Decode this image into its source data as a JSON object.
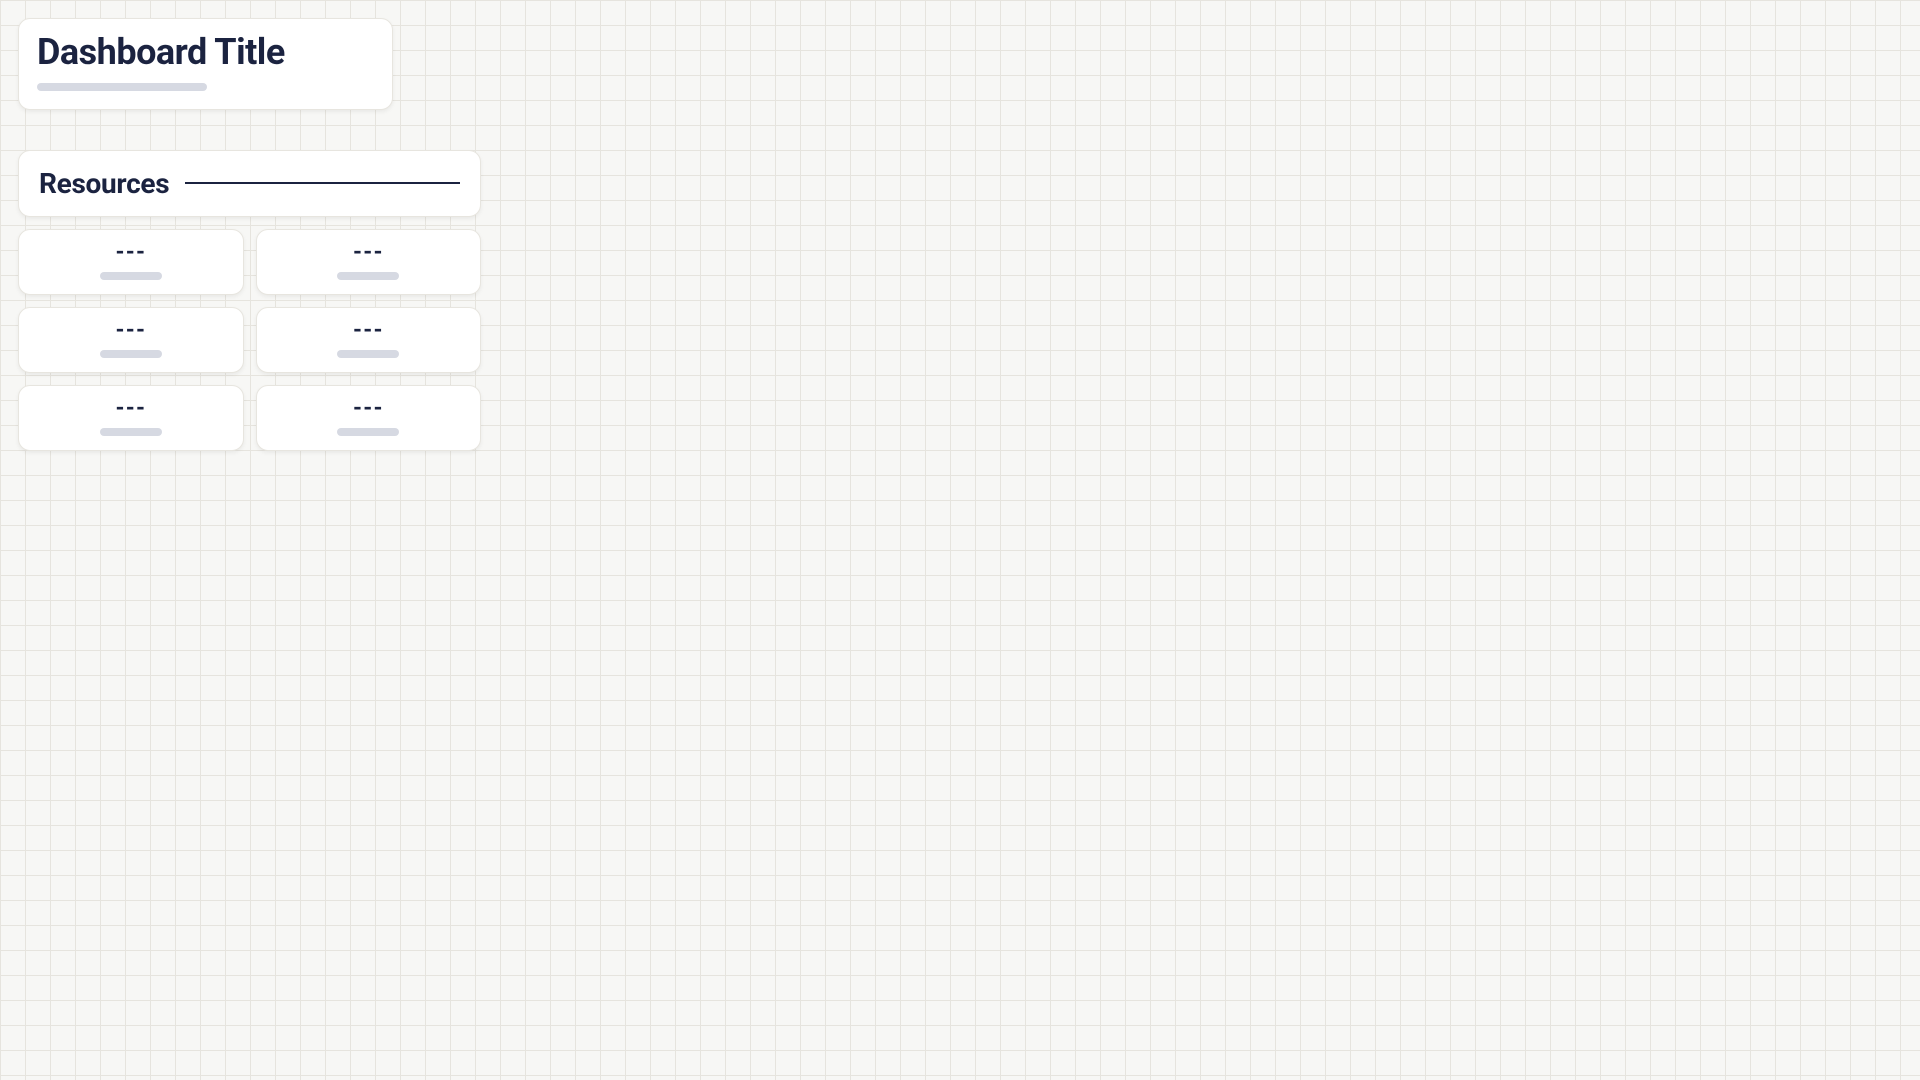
{
  "header": {
    "title": "Dashboard Title"
  },
  "section": {
    "title": "Resources",
    "cards": [
      {
        "value": "---"
      },
      {
        "value": "---"
      },
      {
        "value": "---"
      },
      {
        "value": "---"
      },
      {
        "value": "---"
      },
      {
        "value": "---"
      }
    ]
  }
}
